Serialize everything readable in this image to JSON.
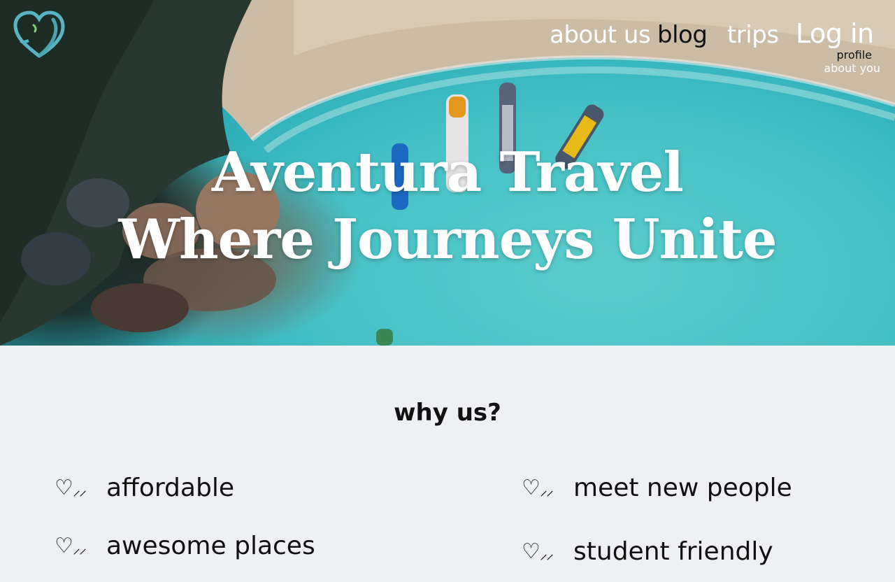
{
  "brand": {
    "logo_icon": "heart-plane-logo-icon",
    "colors": {
      "accent": "#5aa9b8",
      "accent_dark": "#3c8fa0"
    }
  },
  "nav": {
    "about_us": "about us",
    "blog": "blog",
    "trips": "trips",
    "login": "Log in",
    "dropdown": {
      "profile": "profile",
      "about_you": "about you"
    }
  },
  "hero": {
    "title_line_1": "Aventura Travel",
    "title_line_2": "Where Journeys Unite"
  },
  "why_us": {
    "title": "why us?",
    "items": [
      {
        "icon": "heart-check-icon",
        "heart": "♡",
        "ticks": "⸝⸝",
        "label": "affordable"
      },
      {
        "icon": "heart-check-icon",
        "heart": "♡",
        "ticks": "⸝⸝",
        "label": "meet new people"
      },
      {
        "icon": "heart-check-icon",
        "heart": "♡",
        "ticks": "⸝⸝",
        "label": "awesome places"
      },
      {
        "icon": "heart-check-icon",
        "heart": "♡",
        "ticks": "⸝⸝",
        "label": "student friendly"
      }
    ]
  }
}
